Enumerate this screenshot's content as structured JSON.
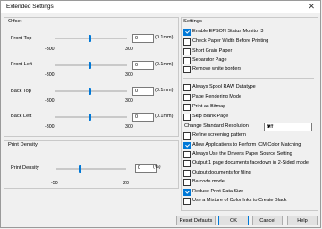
{
  "window": {
    "title": "Extended Settings",
    "close": "✕"
  },
  "offset": {
    "label": "Offset",
    "rows": [
      {
        "label": "Front Top",
        "value": "0",
        "unit": "(0.1mm)",
        "min": "-300",
        "max": "300"
      },
      {
        "label": "Front Left",
        "value": "0",
        "unit": "(0.1mm)",
        "min": "-300",
        "max": "300"
      },
      {
        "label": "Back Top",
        "value": "0",
        "unit": "(0.1mm)",
        "min": "-300",
        "max": "300"
      },
      {
        "label": "Back Left",
        "value": "0",
        "unit": "(0.1mm)",
        "min": "-300",
        "max": "300"
      }
    ]
  },
  "print_density": {
    "label": "Print Density",
    "row": {
      "label": "Print Density",
      "value": "0",
      "unit": "(%)",
      "min": "-50",
      "max": "20"
    }
  },
  "settings": {
    "label": "Settings",
    "group1": [
      {
        "label": "Enable EPSON Status Monitor 3",
        "checked": true
      },
      {
        "label": "Check Paper Width Before Printing",
        "checked": false
      },
      {
        "label": "Short Grain Paper",
        "checked": false
      },
      {
        "label": "Separator Page",
        "checked": false
      },
      {
        "label": "Remove white borders",
        "checked": false
      }
    ],
    "group2": [
      {
        "label": "Always Spool RAW Datatype",
        "checked": false
      },
      {
        "label": "Page Rendering Mode",
        "checked": false
      },
      {
        "label": "Print as Bitmap",
        "checked": false
      },
      {
        "label": "Skip Blank Page",
        "checked": false
      }
    ],
    "change_resolution_label": "Change Standard Resolution",
    "change_resolution_value": "Off",
    "group3": [
      {
        "label": "Refine screening pattern",
        "checked": false
      },
      {
        "label": "Allow Applications to Perform ICM Color Matching",
        "checked": true
      },
      {
        "label": "Always Use the Driver's Paper Source Setting",
        "checked": false
      },
      {
        "label": "Output 1 page documents facedown in 2-Sided mode",
        "checked": false
      },
      {
        "label": "Output documents for filing",
        "checked": false
      },
      {
        "label": "Barcode mode",
        "checked": false
      },
      {
        "label": "Reduce Print Data Size",
        "checked": true
      },
      {
        "label": "Use a Mixture of Color Inks to Create Black",
        "checked": false
      }
    ]
  },
  "buttons": {
    "reset": "Reset Defaults",
    "ok": "OK",
    "cancel": "Cancel",
    "help": "Help"
  },
  "colors": {
    "accent": "#0078d7",
    "window_bg": "#f0f0f0"
  }
}
